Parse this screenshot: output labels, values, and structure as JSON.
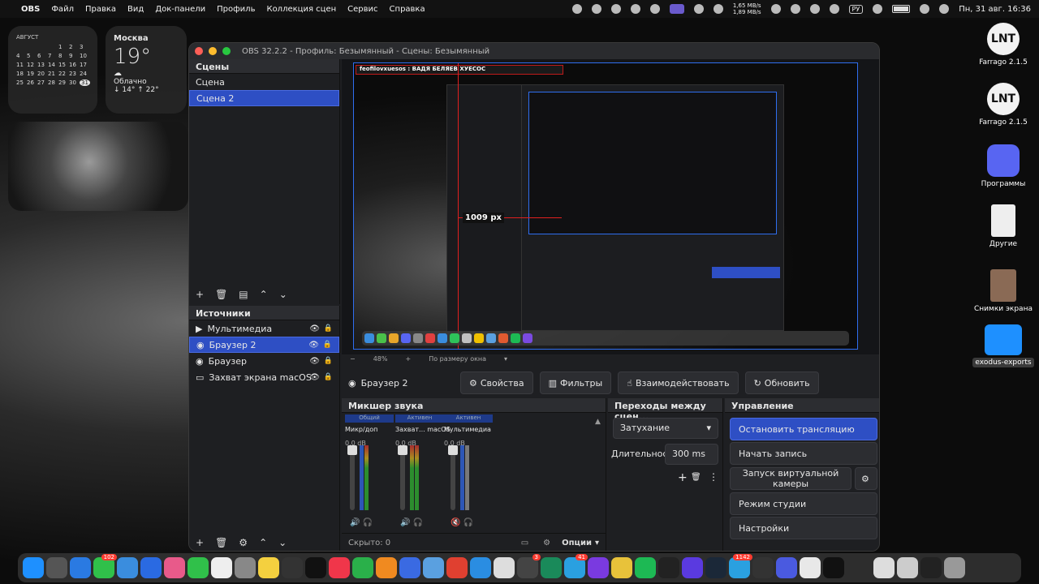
{
  "menubar": {
    "app": "OBS",
    "items": [
      "Файл",
      "Правка",
      "Вид",
      "Док-панели",
      "Профиль",
      "Коллекция сцен",
      "Сервис",
      "Справка"
    ],
    "net_up": "1,65 MB/s",
    "net_down": "1,89 MB/s",
    "lang": "РУ",
    "clock": "Пн, 31 авг.  16:36"
  },
  "calendar": {
    "month": "АВГУСТ",
    "rows": [
      [
        "",
        "",
        "",
        "",
        "1",
        "2",
        "3"
      ],
      [
        "4",
        "5",
        "6",
        "7",
        "8",
        "9",
        "10"
      ],
      [
        "11",
        "12",
        "13",
        "14",
        "15",
        "16",
        "17"
      ],
      [
        "18",
        "19",
        "20",
        "21",
        "22",
        "23",
        "24"
      ],
      [
        "25",
        "26",
        "27",
        "28",
        "29",
        "30",
        "31"
      ]
    ],
    "today": "31"
  },
  "weather": {
    "city": "Москва",
    "temp": "19°",
    "condition": "Облачно",
    "range": "↓ 14° ↑ 22°"
  },
  "desktop_icons": [
    {
      "label": "Farrago 2.1.5",
      "icon": "farrago-icon"
    },
    {
      "label": "Farrago 2.1.5",
      "icon": "farrago-icon"
    },
    {
      "label": "Программы",
      "icon": "discord-icon"
    },
    {
      "label": "Другие",
      "icon": "document-icon"
    },
    {
      "label": "Снимки экрана",
      "icon": "photo-icon"
    },
    {
      "label": "exodus-exports",
      "icon": "folder-icon"
    }
  ],
  "obs": {
    "title": "OBS 32.2.2 - Профиль: Безымянный - Сцены: Безымянный",
    "scenes_header": "Сцены",
    "scenes": [
      "Сцена",
      "Сцена 2"
    ],
    "sources_header": "Источники",
    "sources": [
      {
        "label": "Мультимедиа",
        "icon": "play-icon"
      },
      {
        "label": "Браузер 2",
        "icon": "globe-icon"
      },
      {
        "label": "Браузер",
        "icon": "globe-icon"
      },
      {
        "label": "Захват экрана macOS",
        "icon": "monitor-icon"
      }
    ],
    "preview": {
      "zoom": "48%",
      "fit": "По размеру окна",
      "measure": "1009 px",
      "chat": "feofilovxuesos : ВАДЯ БЕЛЯЕВ ХУЕСОС"
    },
    "context": {
      "source_name": "Браузер 2",
      "properties": "Свойства",
      "filters": "Фильтры",
      "interact": "Взаимодействовать",
      "refresh": "Обновить"
    },
    "mixer": {
      "header": "Микшер звука",
      "channels": [
        {
          "tag": "Общий",
          "name": "Микр/доп",
          "db": "0.0 dB"
        },
        {
          "tag": "Активен",
          "name": "Захват... macOS",
          "db": "0.0 dB"
        },
        {
          "tag": "Активен",
          "name": "Мультимедиа",
          "db": "0.0 dB"
        }
      ],
      "hidden": "Скрыто: 0",
      "options": "Опции"
    },
    "transitions": {
      "header": "Переходы между сцен...",
      "type": "Затухание",
      "duration_label": "Длительность",
      "duration": "300 ms"
    },
    "controls": {
      "header": "Управление",
      "stop_stream": "Остановить трансляцию",
      "start_record": "Начать запись",
      "virtual_cam": "Запуск виртуальной камеры",
      "studio_mode": "Режим студии",
      "settings": "Настройки"
    }
  },
  "dock": {
    "badges": {
      "messages": "102",
      "telegram": "1142",
      "other": "3",
      "sms": "41"
    }
  }
}
